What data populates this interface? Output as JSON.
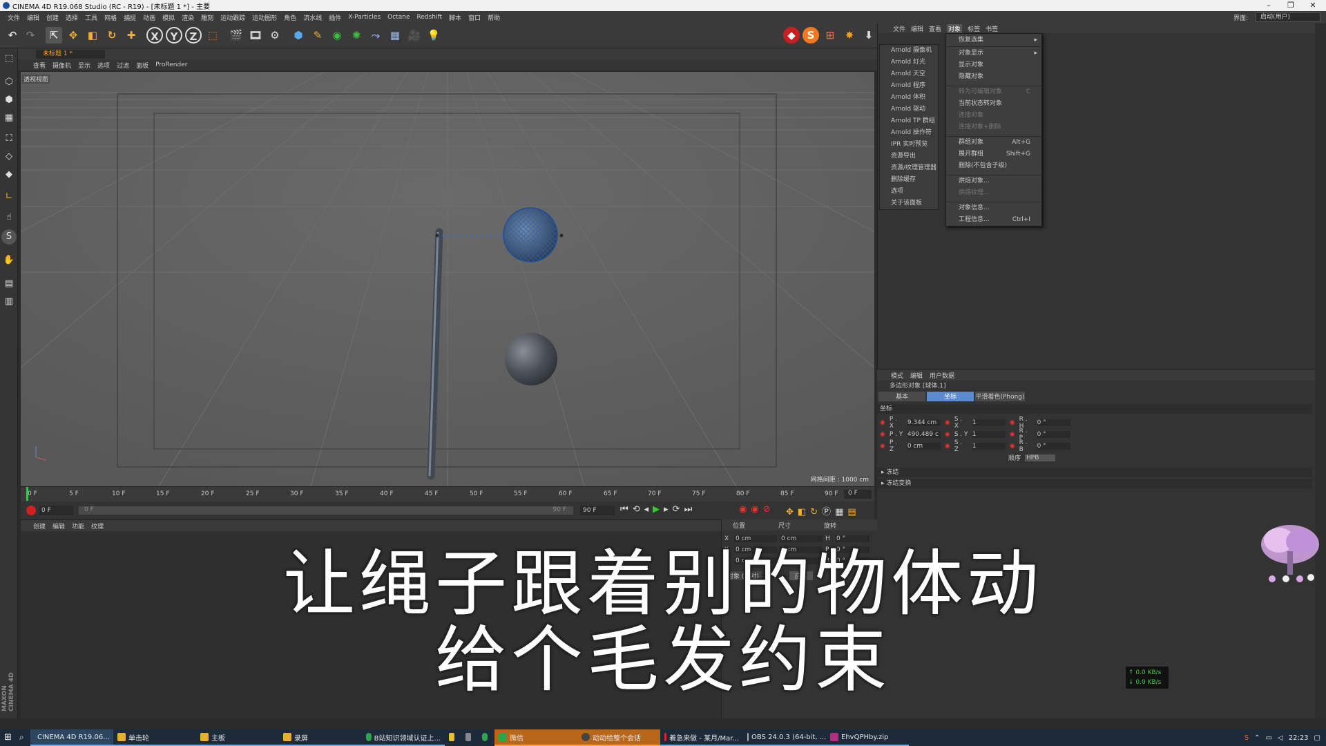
{
  "window": {
    "title": "CINEMA 4D R19.068 Studio (RC - R19) - [未标题 1 *] - 主要",
    "minimize": "–",
    "maximize": "❐",
    "close": "✕"
  },
  "menubar": {
    "items": [
      "文件",
      "编辑",
      "创建",
      "选择",
      "工具",
      "网格",
      "捕捉",
      "动画",
      "模拟",
      "渲染",
      "雕刻",
      "运动跟踪",
      "运动图形",
      "角色",
      "流水线",
      "插件",
      "X-Particles",
      "Octane",
      "Redshift",
      "脚本",
      "窗口",
      "帮助"
    ],
    "layout_label": "界面:",
    "layout_value": "启动(用户)"
  },
  "viewport": {
    "tab": "未标题 1 *",
    "menu": [
      "查看",
      "摄像机",
      "显示",
      "选项",
      "过滤",
      "面板",
      "ProRender"
    ],
    "view_name": "透视视图",
    "grid_info": "网格间距 : 1000 cm"
  },
  "timeline": {
    "ticks": [
      "0 F",
      "5 F",
      "10 F",
      "15 F",
      "20 F",
      "25 F",
      "30 F",
      "35 F",
      "40 F",
      "45 F",
      "50 F",
      "55 F",
      "60 F",
      "65 F",
      "70 F",
      "75 F",
      "80 F",
      "85 F",
      "90 F"
    ],
    "current_frame": "0 F",
    "start": "0 F",
    "range_start": "0 F",
    "range_end": "90 F",
    "end": "90 F"
  },
  "material_panel": {
    "menu": [
      "创建",
      "编辑",
      "功能",
      "纹理"
    ]
  },
  "coord_panel": {
    "headers": [
      "位置",
      "尺寸",
      "旋转"
    ],
    "rows": [
      {
        "axis": "X",
        "pos": "0 cm",
        "size": "0 cm",
        "rot_label": "H",
        "rot": "0 °"
      },
      {
        "axis": "Y",
        "pos": "0 cm",
        "size": "0 cm",
        "rot_label": "P",
        "rot": "0 °"
      },
      {
        "axis": "Z",
        "pos": "0 cm",
        "size": "0 cm",
        "rot_label": "B",
        "rot": "0 °"
      }
    ],
    "mode": "对象 (相对)",
    "apply": "应用"
  },
  "object_manager": {
    "tabs": [
      "文件",
      "编辑",
      "查看",
      "对象",
      "标签",
      "书签"
    ],
    "arnold_menu": [
      "Arnold 摄像机",
      "Arnold 灯光",
      "Arnold 天空",
      "Arnold 程序",
      "Arnold 体积",
      "Arnold 驱动",
      "Arnold TP 群组",
      "Arnold 操作符",
      "IPR 实时预览",
      "资源导出",
      "资源/纹理管理器",
      "删除缓存",
      "选项",
      "关于该面板"
    ],
    "context_menu": [
      {
        "label": "恢复选集",
        "shortcut": "",
        "arrow": "▸",
        "disabled": false
      },
      {
        "label": "对象显示",
        "shortcut": "",
        "arrow": "▸",
        "disabled": false
      },
      {
        "label": "显示对象",
        "shortcut": "",
        "arrow": "",
        "disabled": false
      },
      {
        "label": "隐藏对象",
        "shortcut": "",
        "arrow": "",
        "disabled": false
      },
      {
        "label": "转为可编辑对象",
        "shortcut": "C",
        "arrow": "",
        "disabled": true
      },
      {
        "label": "当前状态转对象",
        "shortcut": "",
        "arrow": "",
        "disabled": false
      },
      {
        "label": "连接对象",
        "shortcut": "",
        "arrow": "",
        "disabled": true
      },
      {
        "label": "连接对象+删除",
        "shortcut": "",
        "arrow": "",
        "disabled": true
      },
      {
        "label": "群组对象",
        "shortcut": "Alt+G",
        "arrow": "",
        "disabled": false
      },
      {
        "label": "展开群组",
        "shortcut": "Shift+G",
        "arrow": "",
        "disabled": false
      },
      {
        "label": "删除(不包含子级)",
        "shortcut": "",
        "arrow": "",
        "disabled": false
      },
      {
        "label": "烘焙对象...",
        "shortcut": "",
        "arrow": "",
        "disabled": false
      },
      {
        "label": "烘焙纹理...",
        "shortcut": "",
        "arrow": "",
        "disabled": true
      },
      {
        "label": "对象信息...",
        "shortcut": "",
        "arrow": "",
        "disabled": false
      },
      {
        "label": "工程信息...",
        "shortcut": "Ctrl+I",
        "arrow": "",
        "disabled": false
      }
    ]
  },
  "attributes": {
    "tabs": [
      "模式",
      "编辑",
      "用户数据"
    ],
    "object_title": "多边形对象 [球体.1]",
    "subtabs": [
      "基本",
      "坐标",
      "平滑着色(Phong)"
    ],
    "section": "坐标",
    "rows": [
      {
        "a": "P . X",
        "av": "9.344 cm",
        "b": "S . X",
        "bv": "1",
        "c": "R . H",
        "cv": "0 °"
      },
      {
        "a": "P . Y",
        "av": "490.489 c",
        "b": "S . Y",
        "bv": "1",
        "c": "R . P",
        "cv": "0 °"
      },
      {
        "a": "P . Z",
        "av": "0 cm",
        "b": "S . Z",
        "bv": "1",
        "c": "R . B",
        "cv": "0 °"
      }
    ],
    "order_label": "顺序",
    "order_value": "HPB",
    "freeze": "▸ 冻结",
    "freeze2": "▸ 冻结变换"
  },
  "caption": {
    "line1": "让绳子跟着别的物体动",
    "line2": "给个毛发约束"
  },
  "net_speed": {
    "up": "↑ 0.0 KB/s",
    "down": "↓ 0.0 KB/s"
  },
  "brand": "MAXON CINEMA 4D",
  "taskbar": {
    "items": [
      {
        "label": "CINEMA 4D R19.06...",
        "color": "#3c7fd6"
      },
      {
        "label": "单击轮",
        "color": "#e8b030"
      },
      {
        "label": "主板",
        "color": "#e8b030"
      },
      {
        "label": "录屏",
        "color": "#e8b030"
      },
      {
        "label": "B站知识领域认证上...",
        "color": "#2da44e"
      },
      {
        "label": "微信",
        "color": "#2da44e"
      },
      {
        "label": "动动给整个会话",
        "color": "#444"
      },
      {
        "label": "着急来做 - 某月/Mar...",
        "color": "#d23"
      },
      {
        "label": "OBS 24.0.3 (64-bit, ...",
        "color": "#333"
      },
      {
        "label": "EhvQPHby.zip",
        "color": "#b03080"
      }
    ],
    "clock": "22:23"
  }
}
